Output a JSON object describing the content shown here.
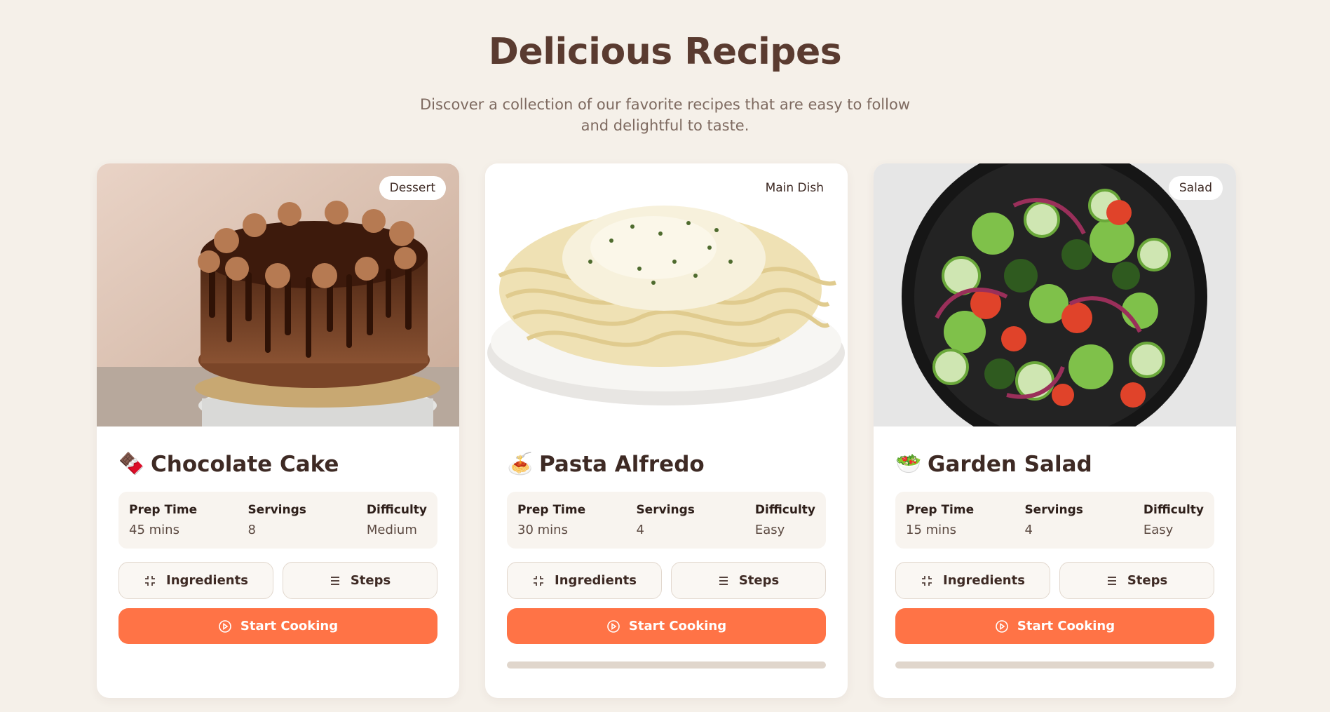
{
  "header": {
    "title": "Delicious Recipes",
    "subtitle": "Discover a collection of our favorite recipes that are easy to follow and delightful to taste."
  },
  "colors": {
    "background": "#f5f0e9",
    "accent": "#ff7346",
    "title": "#5a3b30",
    "card": "#ffffff"
  },
  "labels": {
    "prep_time": "Prep Time",
    "servings": "Servings",
    "difficulty": "Difficulty",
    "ingredients": "Ingredients",
    "steps": "Steps",
    "start_cooking": "Start Cooking"
  },
  "recipes": [
    {
      "category": "Dessert",
      "title": "Chocolate Cake",
      "icon": "chocolate-bar-icon",
      "emoji": "🍫",
      "prep_time": "45 mins",
      "servings": "8",
      "difficulty": "Medium",
      "progress": null
    },
    {
      "category": "Main Dish",
      "title": "Pasta Alfredo",
      "icon": "spaghetti-icon",
      "emoji": "🍝",
      "prep_time": "30 mins",
      "servings": "4",
      "difficulty": "Easy",
      "progress": 0
    },
    {
      "category": "Salad",
      "title": "Garden Salad",
      "icon": "salad-bowl-icon",
      "emoji": "🥗",
      "prep_time": "15 mins",
      "servings": "4",
      "difficulty": "Easy",
      "progress": 0
    }
  ]
}
